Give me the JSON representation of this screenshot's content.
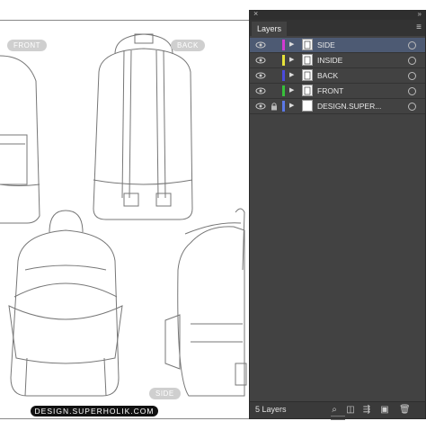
{
  "artboard": {
    "labels": {
      "front": "FRONT",
      "back": "BACK",
      "side": "SIDE"
    },
    "footer": "DESIGN.SUPERHOLIK.COM"
  },
  "panel": {
    "close": "×",
    "collapse": "»",
    "tab": "Layers",
    "menu": "≡",
    "layers": [
      {
        "name": "SIDE",
        "color": "#d23ad2",
        "selected": true,
        "locked": false,
        "thumb": "backpack"
      },
      {
        "name": "INSIDE",
        "color": "#e6e23a",
        "selected": false,
        "locked": false,
        "thumb": "backpack"
      },
      {
        "name": "BACK",
        "color": "#4b4bdc",
        "selected": false,
        "locked": false,
        "thumb": "backpack"
      },
      {
        "name": "FRONT",
        "color": "#37c03a",
        "selected": false,
        "locked": false,
        "thumb": "backpack"
      },
      {
        "name": "DESIGN.SUPER...",
        "color": "#5b78e6",
        "selected": false,
        "locked": true,
        "thumb": "blank"
      }
    ],
    "layer_count": "5 Layers",
    "toolbar_icons": [
      "locate-object-icon",
      "make-clipping-mask-icon",
      "create-sublayer-icon",
      "create-new-layer-icon",
      "delete-icon"
    ]
  }
}
